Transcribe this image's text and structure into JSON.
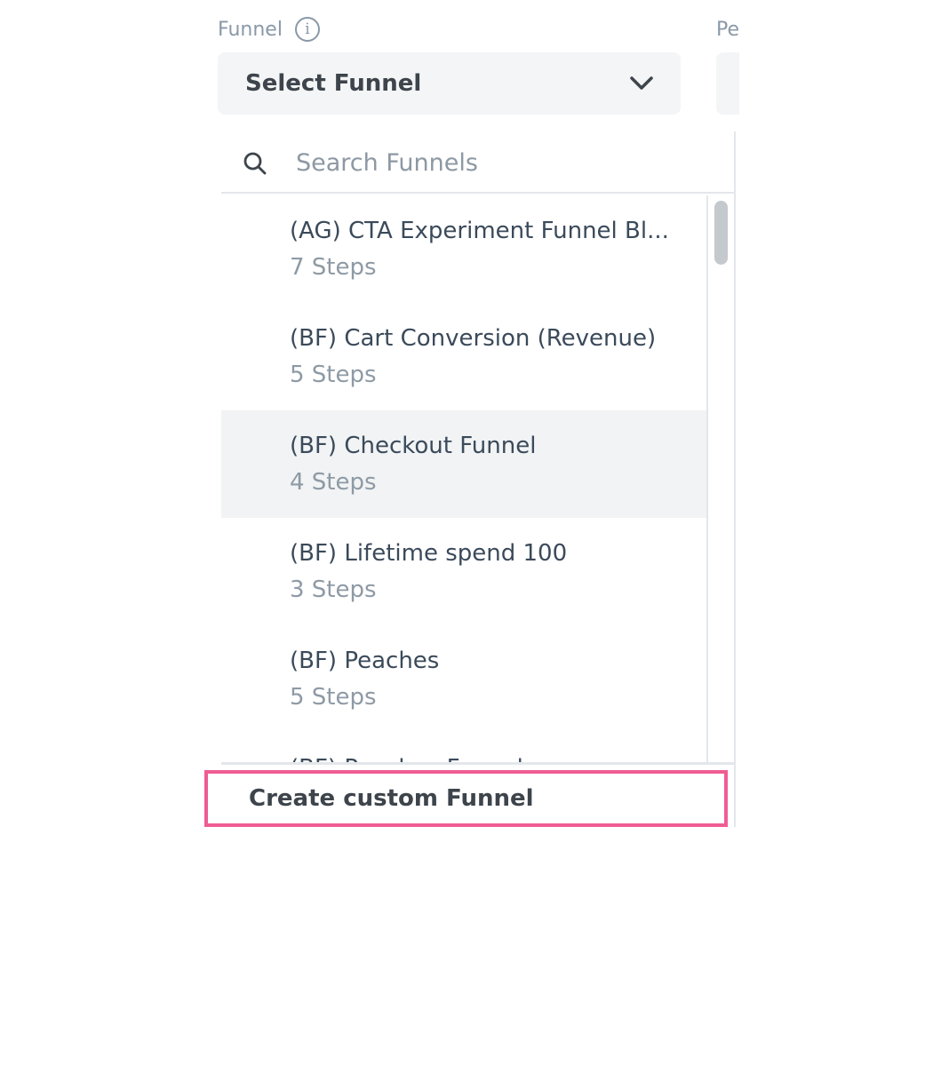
{
  "funnel_field": {
    "label": "Funnel",
    "info_icon": "info-icon",
    "selected_value": "Select Funnel",
    "chevron_icon": "chevron-down-icon"
  },
  "adjacent_field": {
    "label_partial": "Pe"
  },
  "dropdown": {
    "search": {
      "icon": "search-icon",
      "placeholder": "Search Funnels",
      "value": ""
    },
    "items": [
      {
        "name": "(AG) CTA Experiment Funnel Bl...",
        "steps": "7 Steps"
      },
      {
        "name": "(BF) Cart Conversion (Revenue)",
        "steps": "5 Steps"
      },
      {
        "name": "(BF) Checkout Funnel",
        "steps": "4 Steps",
        "highlighted": true
      },
      {
        "name": "(BF) Lifetime spend 100",
        "steps": "3 Steps"
      },
      {
        "name": "(BF) Peaches",
        "steps": "5 Steps"
      },
      {
        "name": "(BF) Peaches Funnel",
        "steps": ""
      }
    ],
    "create_label": "Create custom Funnel"
  },
  "colors": {
    "highlight_border": "#ef5d93",
    "hover_bg": "#f1f3f4",
    "muted_text": "#8e9aa5"
  }
}
